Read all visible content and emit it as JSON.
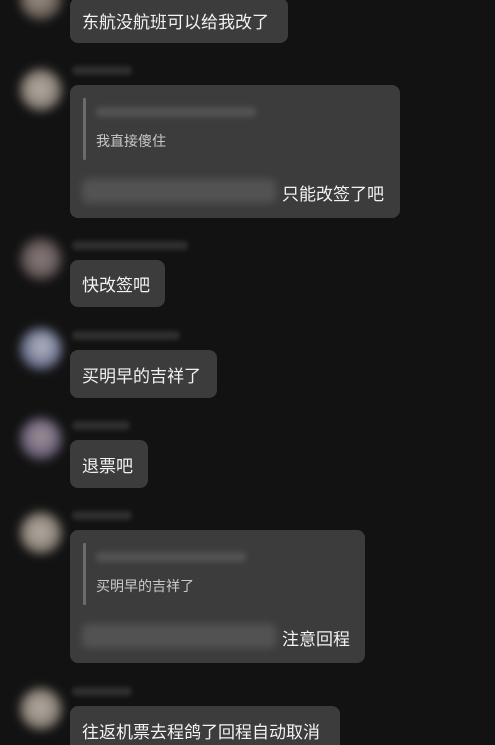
{
  "messages": [
    {
      "text": "东航没航班可以给我改了"
    },
    {
      "quoted": "我直接傻住",
      "text": "只能改签了吧"
    },
    {
      "text": "快改签吧"
    },
    {
      "text": "买明早的吉祥了"
    },
    {
      "text": "退票吧"
    },
    {
      "quoted": "买明早的吉祥了",
      "text": "注意回程"
    },
    {
      "text": "往返机票去程鸽了回程自动取消"
    }
  ],
  "colors": {
    "background": "#121212",
    "bubble": "#3c3c3c",
    "text": "#f2f2f2",
    "quote_text": "#c9c9c9"
  }
}
